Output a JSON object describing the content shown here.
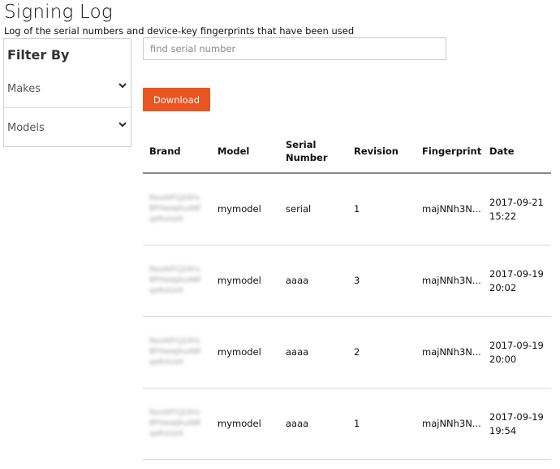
{
  "page": {
    "title": "Signing Log",
    "subtitle": "Log of the serial numbers and device-key fingerprints that have been used"
  },
  "filter": {
    "heading": "Filter By",
    "groups": [
      {
        "label": "Makes",
        "icon": "chevron-down-icon"
      },
      {
        "label": "Models",
        "icon": "chevron-down-icon"
      }
    ]
  },
  "search": {
    "placeholder": "find serial number",
    "value": ""
  },
  "download": {
    "label": "Download",
    "color": "#e95420"
  },
  "table": {
    "headers": {
      "brand": "Brand",
      "model": "Model",
      "serial": "Serial Number",
      "revision": "Revision",
      "fingerprint": "Fingerprint",
      "date": "Date"
    },
    "rows": [
      {
        "brand": "",
        "model": "mymodel",
        "serial": "serial",
        "revision": "1",
        "fingerprint": "majNNh3N...",
        "date": "2017-09-21",
        "time": "15:22"
      },
      {
        "brand": "",
        "model": "mymodel",
        "serial": "aaaa",
        "revision": "3",
        "fingerprint": "majNNh3N...",
        "date": "2017-09-19",
        "time": "20:02"
      },
      {
        "brand": "",
        "model": "mymodel",
        "serial": "aaaa",
        "revision": "2",
        "fingerprint": "majNNh3N...",
        "date": "2017-09-19",
        "time": "20:00"
      },
      {
        "brand": "",
        "model": "mymodel",
        "serial": "aaaa",
        "revision": "1",
        "fingerprint": "majNNh3N...",
        "date": "2017-09-19",
        "time": "19:54"
      }
    ]
  }
}
